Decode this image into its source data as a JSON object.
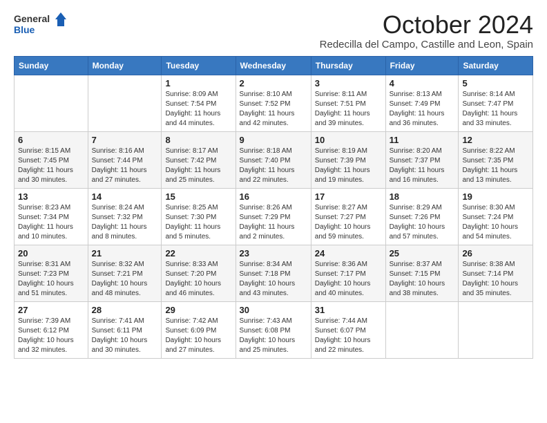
{
  "header": {
    "logo": {
      "general": "General",
      "blue": "Blue"
    },
    "title": "October 2024",
    "subtitle": "Redecilla del Campo, Castille and Leon, Spain"
  },
  "calendar": {
    "days_of_week": [
      "Sunday",
      "Monday",
      "Tuesday",
      "Wednesday",
      "Thursday",
      "Friday",
      "Saturday"
    ],
    "weeks": [
      [
        {
          "day": "",
          "info": ""
        },
        {
          "day": "",
          "info": ""
        },
        {
          "day": "1",
          "info": "Sunrise: 8:09 AM\nSunset: 7:54 PM\nDaylight: 11 hours and 44 minutes."
        },
        {
          "day": "2",
          "info": "Sunrise: 8:10 AM\nSunset: 7:52 PM\nDaylight: 11 hours and 42 minutes."
        },
        {
          "day": "3",
          "info": "Sunrise: 8:11 AM\nSunset: 7:51 PM\nDaylight: 11 hours and 39 minutes."
        },
        {
          "day": "4",
          "info": "Sunrise: 8:13 AM\nSunset: 7:49 PM\nDaylight: 11 hours and 36 minutes."
        },
        {
          "day": "5",
          "info": "Sunrise: 8:14 AM\nSunset: 7:47 PM\nDaylight: 11 hours and 33 minutes."
        }
      ],
      [
        {
          "day": "6",
          "info": "Sunrise: 8:15 AM\nSunset: 7:45 PM\nDaylight: 11 hours and 30 minutes."
        },
        {
          "day": "7",
          "info": "Sunrise: 8:16 AM\nSunset: 7:44 PM\nDaylight: 11 hours and 27 minutes."
        },
        {
          "day": "8",
          "info": "Sunrise: 8:17 AM\nSunset: 7:42 PM\nDaylight: 11 hours and 25 minutes."
        },
        {
          "day": "9",
          "info": "Sunrise: 8:18 AM\nSunset: 7:40 PM\nDaylight: 11 hours and 22 minutes."
        },
        {
          "day": "10",
          "info": "Sunrise: 8:19 AM\nSunset: 7:39 PM\nDaylight: 11 hours and 19 minutes."
        },
        {
          "day": "11",
          "info": "Sunrise: 8:20 AM\nSunset: 7:37 PM\nDaylight: 11 hours and 16 minutes."
        },
        {
          "day": "12",
          "info": "Sunrise: 8:22 AM\nSunset: 7:35 PM\nDaylight: 11 hours and 13 minutes."
        }
      ],
      [
        {
          "day": "13",
          "info": "Sunrise: 8:23 AM\nSunset: 7:34 PM\nDaylight: 11 hours and 10 minutes."
        },
        {
          "day": "14",
          "info": "Sunrise: 8:24 AM\nSunset: 7:32 PM\nDaylight: 11 hours and 8 minutes."
        },
        {
          "day": "15",
          "info": "Sunrise: 8:25 AM\nSunset: 7:30 PM\nDaylight: 11 hours and 5 minutes."
        },
        {
          "day": "16",
          "info": "Sunrise: 8:26 AM\nSunset: 7:29 PM\nDaylight: 11 hours and 2 minutes."
        },
        {
          "day": "17",
          "info": "Sunrise: 8:27 AM\nSunset: 7:27 PM\nDaylight: 10 hours and 59 minutes."
        },
        {
          "day": "18",
          "info": "Sunrise: 8:29 AM\nSunset: 7:26 PM\nDaylight: 10 hours and 57 minutes."
        },
        {
          "day": "19",
          "info": "Sunrise: 8:30 AM\nSunset: 7:24 PM\nDaylight: 10 hours and 54 minutes."
        }
      ],
      [
        {
          "day": "20",
          "info": "Sunrise: 8:31 AM\nSunset: 7:23 PM\nDaylight: 10 hours and 51 minutes."
        },
        {
          "day": "21",
          "info": "Sunrise: 8:32 AM\nSunset: 7:21 PM\nDaylight: 10 hours and 48 minutes."
        },
        {
          "day": "22",
          "info": "Sunrise: 8:33 AM\nSunset: 7:20 PM\nDaylight: 10 hours and 46 minutes."
        },
        {
          "day": "23",
          "info": "Sunrise: 8:34 AM\nSunset: 7:18 PM\nDaylight: 10 hours and 43 minutes."
        },
        {
          "day": "24",
          "info": "Sunrise: 8:36 AM\nSunset: 7:17 PM\nDaylight: 10 hours and 40 minutes."
        },
        {
          "day": "25",
          "info": "Sunrise: 8:37 AM\nSunset: 7:15 PM\nDaylight: 10 hours and 38 minutes."
        },
        {
          "day": "26",
          "info": "Sunrise: 8:38 AM\nSunset: 7:14 PM\nDaylight: 10 hours and 35 minutes."
        }
      ],
      [
        {
          "day": "27",
          "info": "Sunrise: 7:39 AM\nSunset: 6:12 PM\nDaylight: 10 hours and 32 minutes."
        },
        {
          "day": "28",
          "info": "Sunrise: 7:41 AM\nSunset: 6:11 PM\nDaylight: 10 hours and 30 minutes."
        },
        {
          "day": "29",
          "info": "Sunrise: 7:42 AM\nSunset: 6:09 PM\nDaylight: 10 hours and 27 minutes."
        },
        {
          "day": "30",
          "info": "Sunrise: 7:43 AM\nSunset: 6:08 PM\nDaylight: 10 hours and 25 minutes."
        },
        {
          "day": "31",
          "info": "Sunrise: 7:44 AM\nSunset: 6:07 PM\nDaylight: 10 hours and 22 minutes."
        },
        {
          "day": "",
          "info": ""
        },
        {
          "day": "",
          "info": ""
        }
      ]
    ]
  }
}
